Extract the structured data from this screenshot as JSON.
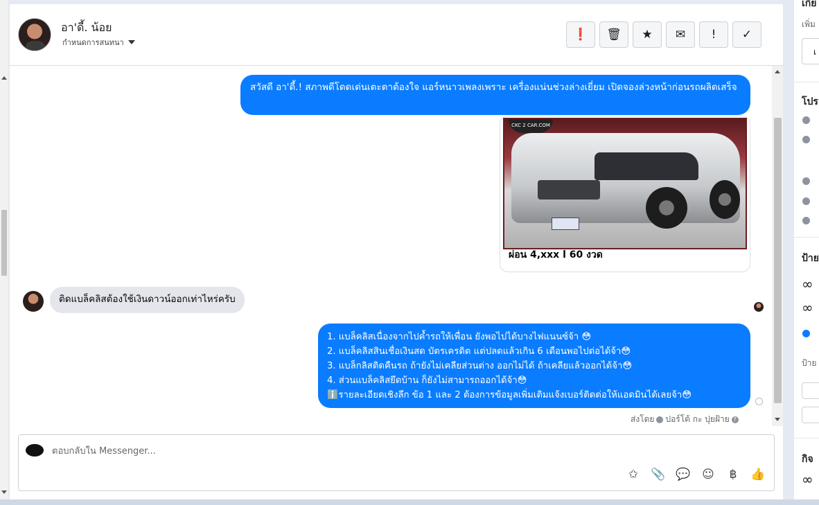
{
  "header": {
    "contact_name": "อา'ดี้. น้อย",
    "assign_label": "กำหนดการสนทนา",
    "actions": [
      {
        "icon": "alert-circle-icon",
        "glyph": "❗"
      },
      {
        "icon": "trash-icon",
        "glyph": "🗑"
      },
      {
        "icon": "star-icon",
        "glyph": "★"
      },
      {
        "icon": "mail-icon",
        "glyph": "✉"
      },
      {
        "icon": "exclamation-icon",
        "glyph": "!"
      },
      {
        "icon": "check-icon",
        "glyph": "✓"
      }
    ]
  },
  "messages": {
    "out_1": "สวัสดี อา'ดี้.! สภาพดีโดดเด่นเตะตาต้องใจ แอร์หนาวเพลงเพราะ เครื่องแน่นช่วงล่างเยี่ยม เปิดจองล่วงหน้าก่อนรถผลิตเสร็จ",
    "card_caption": "ผ่อน 4,xxx l 60 งวด",
    "card_logo": "CKC 2 CAR.COM",
    "in_1": "ติดแบล็คลิสต้องใช้เงินดาวน์ออกเท่าไหร่ครับ",
    "out_2_lines": [
      "1. แบล็คลิสเนื่องจากไปค้ำรถให้เพื่อน ยังพอไปได้บางไฟแนนซ์จ้า 😳",
      "2. แบล็คลิสสินเชื่อเงินสด บัตรเครดิต แต่ปลดแล้วเกิน 6 เดือนพอไปต่อได้จ้า😳",
      "3. แบล็กลิสติดคืนรถ ถ้ายังไม่เคลียส่วนต่าง ออกไม่ได้ ถ้าเคลียแล้วออกได้จ้า😳",
      "4. ส่วนแบล็คลิสยึดบ้าน ก็ยังไม่สามารถออกได้จ้า😳",
      "ℹ️รายละเอียดเชิงลึก ข้อ 1 และ 2 ต้องการข้อมูลเพิ่มเติมแจ้งเบอร์ติดต่อให้แอดมินได้เลยจ้า😳"
    ],
    "sent_by_prefix": "ส่งโดย",
    "sent_by_name": "ปอร์โต้ กะ ปุยฝ้าย"
  },
  "reply": {
    "placeholder": "ตอบกลับใน Messenger...",
    "tools": [
      {
        "icon": "saved-reply-icon",
        "glyph": "✩"
      },
      {
        "icon": "attachment-icon",
        "glyph": "📎"
      },
      {
        "icon": "chat-bubble-icon",
        "glyph": "💬"
      },
      {
        "icon": "emoji-icon",
        "glyph": "☺"
      },
      {
        "icon": "baht-icon",
        "glyph": "฿"
      },
      {
        "icon": "thumbs-up-icon",
        "glyph": "👍"
      }
    ]
  },
  "right_panel": {
    "top_text": "เกีย",
    "add_text": "เพิ่ม",
    "field_text": "เ",
    "profile_heading": "โปร",
    "labels_heading": "ป้าย",
    "labels_sub": "ป้าย",
    "activity_heading": "กิจ"
  }
}
